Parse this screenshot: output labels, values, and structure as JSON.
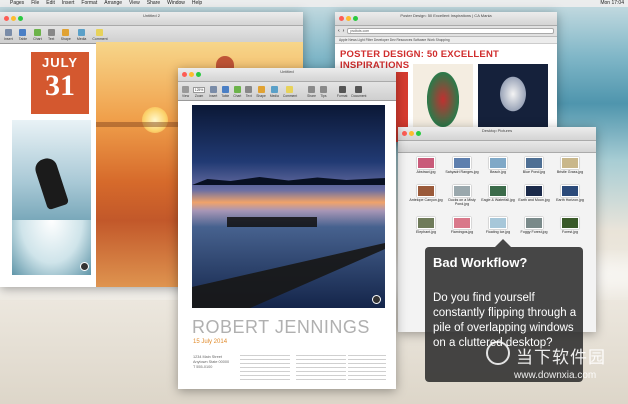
{
  "menubar": {
    "app": "Pages",
    "items": [
      "File",
      "Edit",
      "Insert",
      "Format",
      "Arrange",
      "View",
      "Share",
      "Window",
      "Help"
    ],
    "clock": "Mon 17:04"
  },
  "win_left": {
    "title": "Untitled 2",
    "tools": [
      "Insert",
      "Table",
      "Chart",
      "Text",
      "Shape",
      "Media",
      "Comment"
    ],
    "calendar_month": "JULY",
    "calendar_day": "31"
  },
  "win_browser": {
    "tab_title": "Poster Design: 50 Excellent Inspirations | CA Mania",
    "url": "psdtuts.com",
    "bookmarks": "Apple   News   Light Filter   Developer   Dev Resources   Software   Work   Shopping",
    "headline": "POSTER DESIGN: 50 EXCELLENT INSPIRATIONS"
  },
  "win_finder": {
    "title": "Desktop Pictures",
    "files": [
      "Abstract.jpg",
      "Sahyadri Ranges.jpg",
      "Beach.jpg",
      "Blue Pond.jpg",
      "Bristle Grass.jpg",
      "Antelope Canyon.jpg",
      "Ducks on a Misty Pond.jpg",
      "Eagle & Waterfall.jpg",
      "Earth and Moon.jpg",
      "Earth Horizon.jpg",
      "Elephant.jpg",
      "Flamingos.jpg",
      "Floating Ice.jpg",
      "Foggy Forest.jpg",
      "Forest.jpg"
    ],
    "thumb_colors": [
      "#c95b7a",
      "#5e7fae",
      "#7fa8c7",
      "#4e6f94",
      "#c9b78b",
      "#9a5a3a",
      "#9aa8ad",
      "#3b6b4a",
      "#1b2a4a",
      "#2b4a7a",
      "#6f7b5a",
      "#d9788a",
      "#a7c7d9",
      "#7a8a8a",
      "#3a5a2a"
    ]
  },
  "win_doc": {
    "title": "Untitled",
    "zoom": "125%",
    "tools": [
      "View",
      "Zoom",
      "Insert",
      "Table",
      "Chart",
      "Text",
      "Shape",
      "Media",
      "Comment",
      "Share",
      "Tips",
      "Format",
      "Document"
    ],
    "name": "ROBERT JENNINGS",
    "date": "15 July 2014",
    "address": "1234 Main Street\nAnytown State 00000\nT 555-0100"
  },
  "callout": {
    "title": "Bad Workflow?",
    "body": "Do you find yourself constantly flipping through a pile of overlapping windows on a cluttered desktop?"
  },
  "watermark": {
    "cn": "当下软件园",
    "url": "www.downxia.com"
  }
}
